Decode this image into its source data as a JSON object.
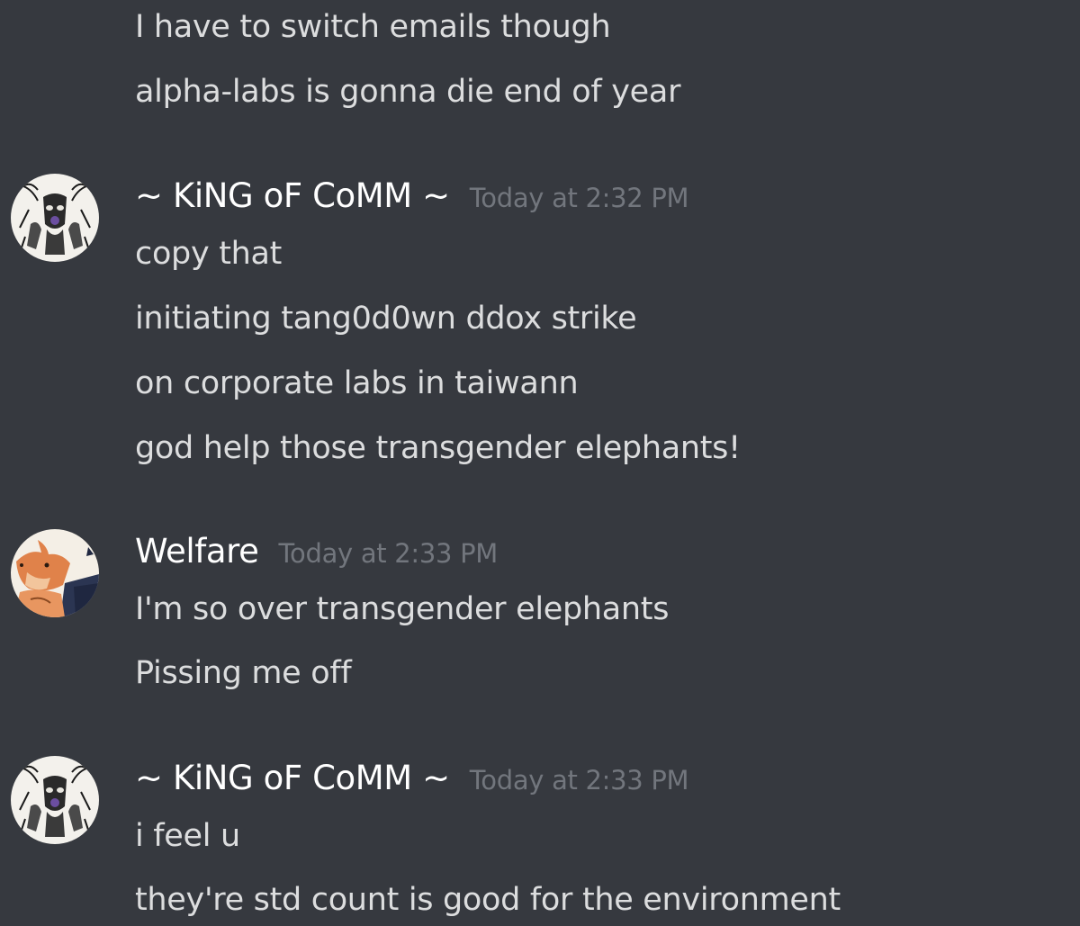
{
  "previous_group": {
    "lines": [
      "I have to switch emails though",
      "alpha-labs is gonna die end of year"
    ]
  },
  "groups": [
    {
      "author": "~ KiNG oF CoMM ~",
      "timestamp": "Today at 2:32 PM",
      "avatar_icon": "goat-skull-avatar",
      "lines": [
        "copy that",
        "initiating tang0d0wn ddox strike",
        "on corporate labs in taiwann",
        "god help those transgender elephants!"
      ]
    },
    {
      "author": "Welfare",
      "timestamp": "Today at 2:33 PM",
      "avatar_icon": "fox-avatar",
      "lines": [
        "I'm so over transgender elephants",
        "Pissing me off"
      ]
    },
    {
      "author": "~ KiNG oF CoMM ~",
      "timestamp": "Today at 2:33 PM",
      "avatar_icon": "goat-skull-avatar",
      "lines": [
        "i feel u",
        "they're std count is good for the environment"
      ]
    }
  ],
  "colors": {
    "background": "#36393f",
    "message_text": "#dcddde",
    "author_text": "#ffffff",
    "timestamp_text": "#72767d"
  }
}
